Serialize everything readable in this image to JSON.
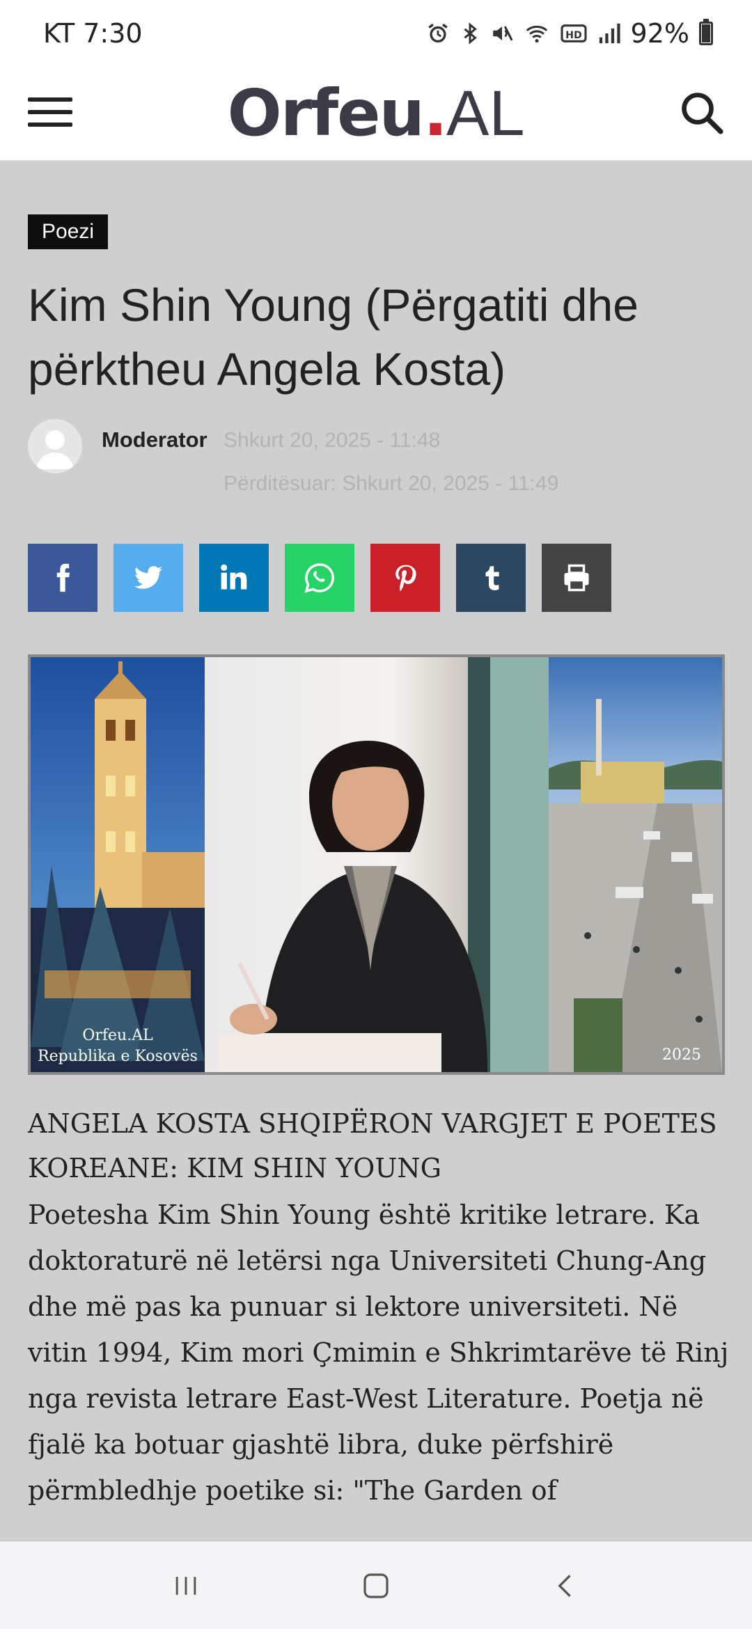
{
  "status_bar": {
    "time": "KT 7:30",
    "battery": "92%",
    "battery_level": 0.92
  },
  "header": {
    "logo_part1": "Orfeu",
    "logo_dot": ".",
    "logo_part2": "AL",
    "menu_icon": "hamburger-menu-icon",
    "search_icon": "search-icon",
    "brand_dot_color": "#c8272f"
  },
  "article": {
    "category": "Poezi",
    "title": "Kim Shin Young (Përgatiti dhe përktheu Angela Kosta)",
    "author": "Moderator",
    "date": "Shkurt 20, 2025 - 11:48",
    "updated": "Përditësuar: Shkurt 20, 2025 - 11:49",
    "share_buttons": [
      {
        "name": "facebook",
        "icon": "facebook-icon",
        "color": "#3b5998"
      },
      {
        "name": "twitter",
        "icon": "twitter-icon",
        "color": "#55acee"
      },
      {
        "name": "linkedin",
        "icon": "linkedin-icon",
        "color": "#0077b5"
      },
      {
        "name": "whatsapp",
        "icon": "whatsapp-icon",
        "color": "#25d366"
      },
      {
        "name": "pinterest",
        "icon": "pinterest-icon",
        "color": "#cb2027"
      },
      {
        "name": "tumblr",
        "icon": "tumblr-icon",
        "color": "#2c4762"
      },
      {
        "name": "print",
        "icon": "print-icon",
        "color": "#444444"
      }
    ],
    "image": {
      "caption_left_line1": "Orfeu.AL",
      "caption_left_line2": "Republika e Kosovës",
      "caption_right": "2025"
    },
    "subtitle": "ANGELA KOSTA SHQIPËRON VARGJET E POETES KOREANE: KIM SHIN YOUNG",
    "body": "Poetesha Kim Shin Young është kritike letrare. Ka doktoraturë në letërsi nga Universiteti Chung-Ang dhe më pas ka punuar si lektore universiteti. Në vitin 1994, Kim mori Çmimin e Shkrimtarëve të Rinj nga revista letrare East-West Literature. Poetja në fjalë ka botuar gjashtë libra, duke përfshirë përmbledhje poetike si: \"The Garden of"
  },
  "navigation": {
    "recents_icon": "recents-icon",
    "home_icon": "home-icon",
    "back_icon": "back-icon"
  }
}
